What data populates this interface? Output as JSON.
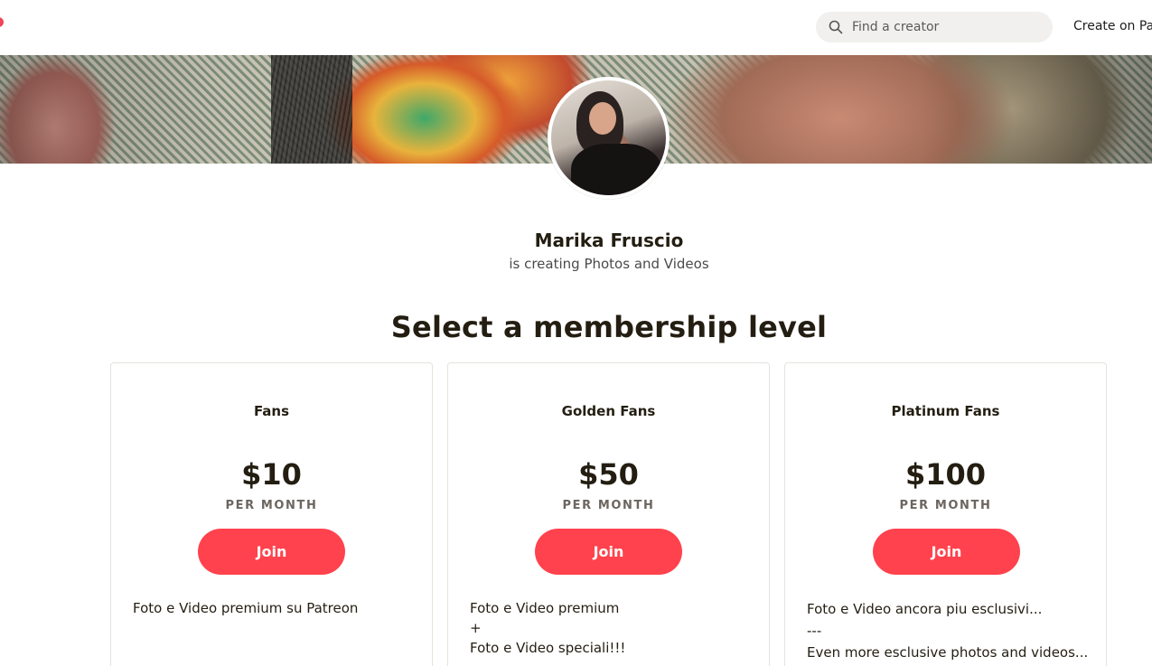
{
  "header": {
    "search_placeholder": "Find a creator",
    "create_link": "Create on Patreon"
  },
  "creator": {
    "name": "Marika Fruscio",
    "subtitle": "is creating Photos and Videos"
  },
  "membership": {
    "title": "Select a membership level",
    "tiers": [
      {
        "name": "Fans",
        "price": "$10",
        "period": "PER MONTH",
        "join_label": "Join",
        "description": [
          "Foto e Video premium su Patreon"
        ]
      },
      {
        "name": "Golden Fans",
        "price": "$50",
        "period": "PER MONTH",
        "join_label": "Join",
        "description": [
          "Foto e Video premium",
          "+",
          "Foto e Video speciali!!!"
        ]
      },
      {
        "name": "Platinum Fans",
        "price": "$100",
        "period": "PER MONTH",
        "join_label": "Join",
        "description": [
          "Foto e Video ancora piu esclusivi...",
          "---",
          "Even more esclusive photos and videos..."
        ]
      }
    ]
  },
  "colors": {
    "accent": "#ff424d",
    "text": "#241e12",
    "muted": "#6b6660",
    "search_bg": "#f1f0ee",
    "card_border": "#e5e3dd"
  }
}
